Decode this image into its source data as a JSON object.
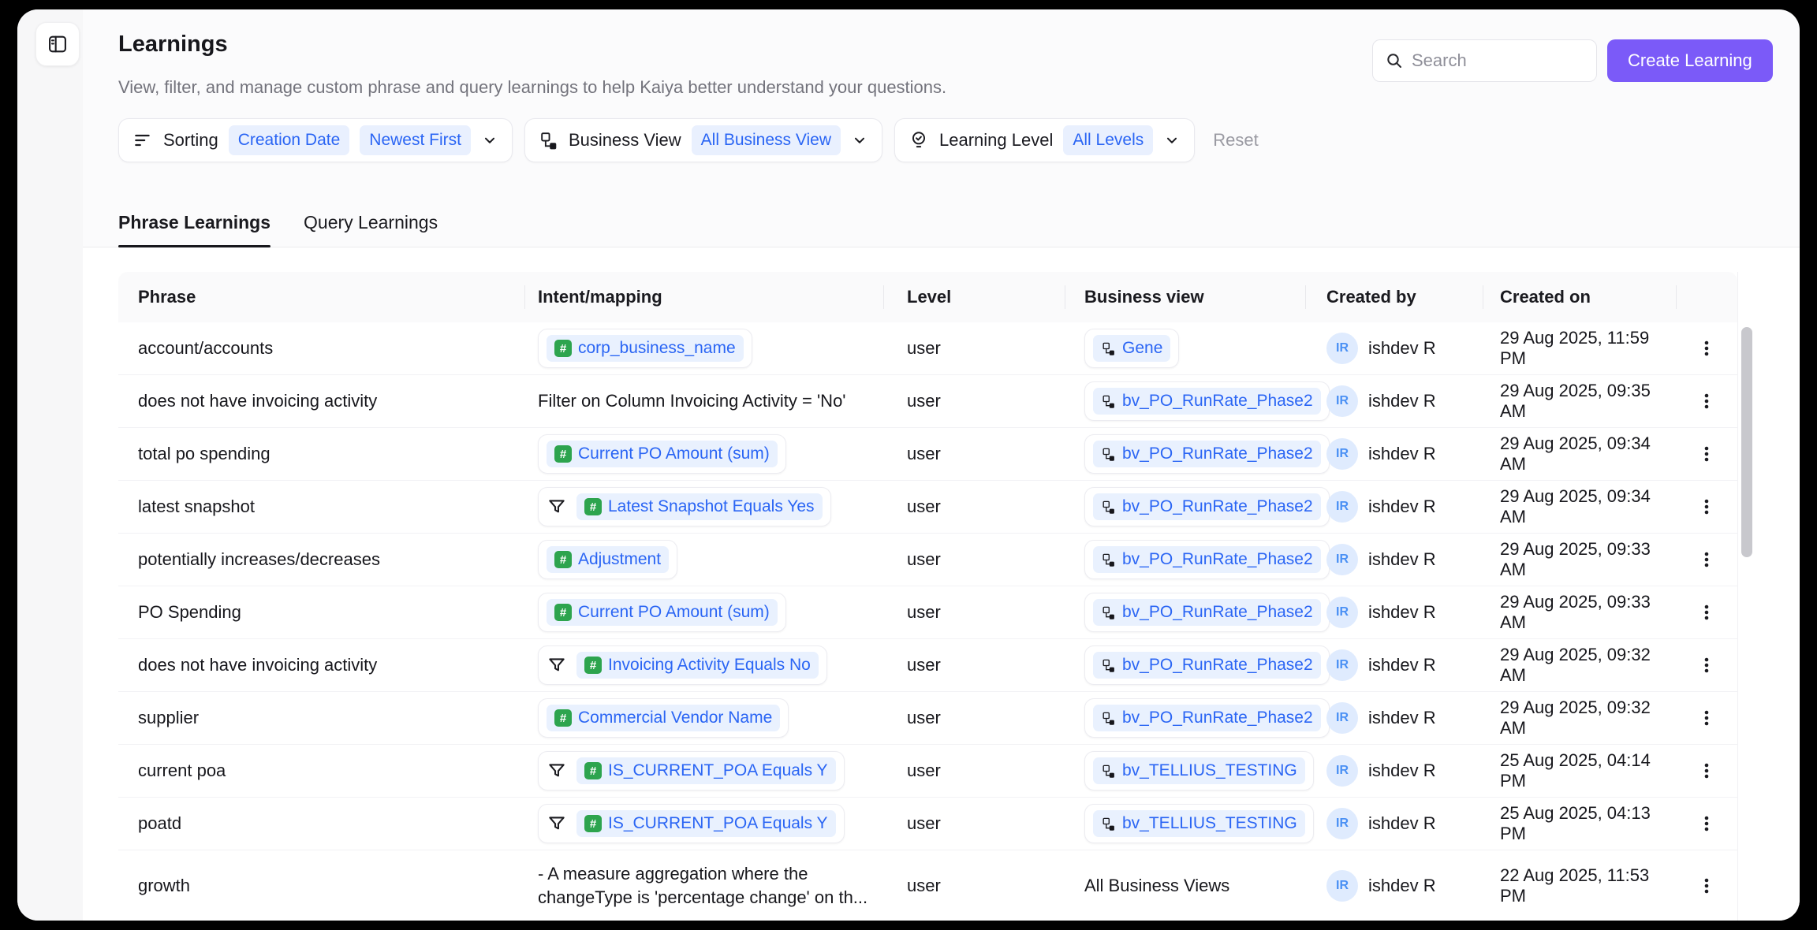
{
  "header": {
    "title": "Learnings",
    "subtitle": "View, filter, and manage custom phrase and query learnings to help Kaiya better understand your questions.",
    "search_placeholder": "Search",
    "create_button_label": "Create Learning"
  },
  "filters": {
    "sorting": {
      "label": "Sorting",
      "values": [
        "Creation Date",
        "Newest First"
      ]
    },
    "business_view": {
      "label": "Business View",
      "value": "All Business View"
    },
    "learning_level": {
      "label": "Learning Level",
      "value": "All Levels"
    },
    "reset_label": "Reset"
  },
  "tabs": [
    {
      "label": "Phrase Learnings",
      "active": true
    },
    {
      "label": "Query Learnings",
      "active": false
    }
  ],
  "table": {
    "columns": [
      "Phrase",
      "Intent/mapping",
      "Level",
      "Business view",
      "Created by",
      "Created on"
    ],
    "rows": [
      {
        "phrase": "account/accounts",
        "intent": {
          "kind": "chip",
          "filter": false,
          "label": "corp_business_name"
        },
        "level": "user",
        "business_view": {
          "kind": "chip",
          "label": "Gene"
        },
        "created_by": {
          "initials": "IR",
          "name": "ishdev R"
        },
        "created_on": "29 Aug 2025, 11:59 PM"
      },
      {
        "phrase": "does not have invoicing activity",
        "intent": {
          "kind": "text",
          "label": "Filter on Column Invoicing Activity = 'No'"
        },
        "level": "user",
        "business_view": {
          "kind": "chip",
          "label": "bv_PO_RunRate_Phase2"
        },
        "created_by": {
          "initials": "IR",
          "name": "ishdev R"
        },
        "created_on": "29 Aug 2025, 09:35 AM"
      },
      {
        "phrase": "total po spending",
        "intent": {
          "kind": "chip",
          "filter": false,
          "label": "Current PO Amount (sum)"
        },
        "level": "user",
        "business_view": {
          "kind": "chip",
          "label": "bv_PO_RunRate_Phase2"
        },
        "created_by": {
          "initials": "IR",
          "name": "ishdev R"
        },
        "created_on": "29 Aug 2025, 09:34 AM"
      },
      {
        "phrase": "latest snapshot",
        "intent": {
          "kind": "chip",
          "filter": true,
          "label": "Latest Snapshot Equals Yes"
        },
        "level": "user",
        "business_view": {
          "kind": "chip",
          "label": "bv_PO_RunRate_Phase2"
        },
        "created_by": {
          "initials": "IR",
          "name": "ishdev R"
        },
        "created_on": "29 Aug 2025, 09:34 AM"
      },
      {
        "phrase": "potentially increases/decreases",
        "intent": {
          "kind": "chip",
          "filter": false,
          "label": "Adjustment"
        },
        "level": "user",
        "business_view": {
          "kind": "chip",
          "label": "bv_PO_RunRate_Phase2"
        },
        "created_by": {
          "initials": "IR",
          "name": "ishdev R"
        },
        "created_on": "29 Aug 2025, 09:33 AM"
      },
      {
        "phrase": "PO Spending",
        "intent": {
          "kind": "chip",
          "filter": false,
          "label": "Current PO Amount (sum)"
        },
        "level": "user",
        "business_view": {
          "kind": "chip",
          "label": "bv_PO_RunRate_Phase2"
        },
        "created_by": {
          "initials": "IR",
          "name": "ishdev R"
        },
        "created_on": "29 Aug 2025, 09:33 AM"
      },
      {
        "phrase": "does not have invoicing activity",
        "intent": {
          "kind": "chip",
          "filter": true,
          "label": "Invoicing Activity Equals No"
        },
        "level": "user",
        "business_view": {
          "kind": "chip",
          "label": "bv_PO_RunRate_Phase2"
        },
        "created_by": {
          "initials": "IR",
          "name": "ishdev R"
        },
        "created_on": "29 Aug 2025, 09:32 AM"
      },
      {
        "phrase": "supplier",
        "intent": {
          "kind": "chip",
          "filter": false,
          "label": "Commercial Vendor Name"
        },
        "level": "user",
        "business_view": {
          "kind": "chip",
          "label": "bv_PO_RunRate_Phase2"
        },
        "created_by": {
          "initials": "IR",
          "name": "ishdev R"
        },
        "created_on": "29 Aug 2025, 09:32 AM"
      },
      {
        "phrase": "current poa",
        "intent": {
          "kind": "chip",
          "filter": true,
          "label": "IS_CURRENT_POA Equals Y"
        },
        "level": "user",
        "business_view": {
          "kind": "chip",
          "label": "bv_TELLIUS_TESTING"
        },
        "created_by": {
          "initials": "IR",
          "name": "ishdev R"
        },
        "created_on": "25 Aug 2025, 04:14 PM"
      },
      {
        "phrase": "poatd",
        "intent": {
          "kind": "chip",
          "filter": true,
          "label": "IS_CURRENT_POA Equals Y"
        },
        "level": "user",
        "business_view": {
          "kind": "chip",
          "label": "bv_TELLIUS_TESTING"
        },
        "created_by": {
          "initials": "IR",
          "name": "ishdev R"
        },
        "created_on": "25 Aug 2025, 04:13 PM"
      },
      {
        "phrase": "growth",
        "intent": {
          "kind": "text",
          "label": "- A measure aggregation where the changeType is 'percentage change' on th..."
        },
        "level": "user",
        "business_view": {
          "kind": "text",
          "label": "All Business Views"
        },
        "created_by": {
          "initials": "IR",
          "name": "ishdev R"
        },
        "created_on": "22 Aug 2025, 11:53 PM"
      }
    ]
  },
  "colors": {
    "accent_purple": "#7B5AF8",
    "link_blue": "#2A65F4",
    "pill_blue_bg": "#E9F1FE",
    "badge_green": "#2DA44E"
  }
}
